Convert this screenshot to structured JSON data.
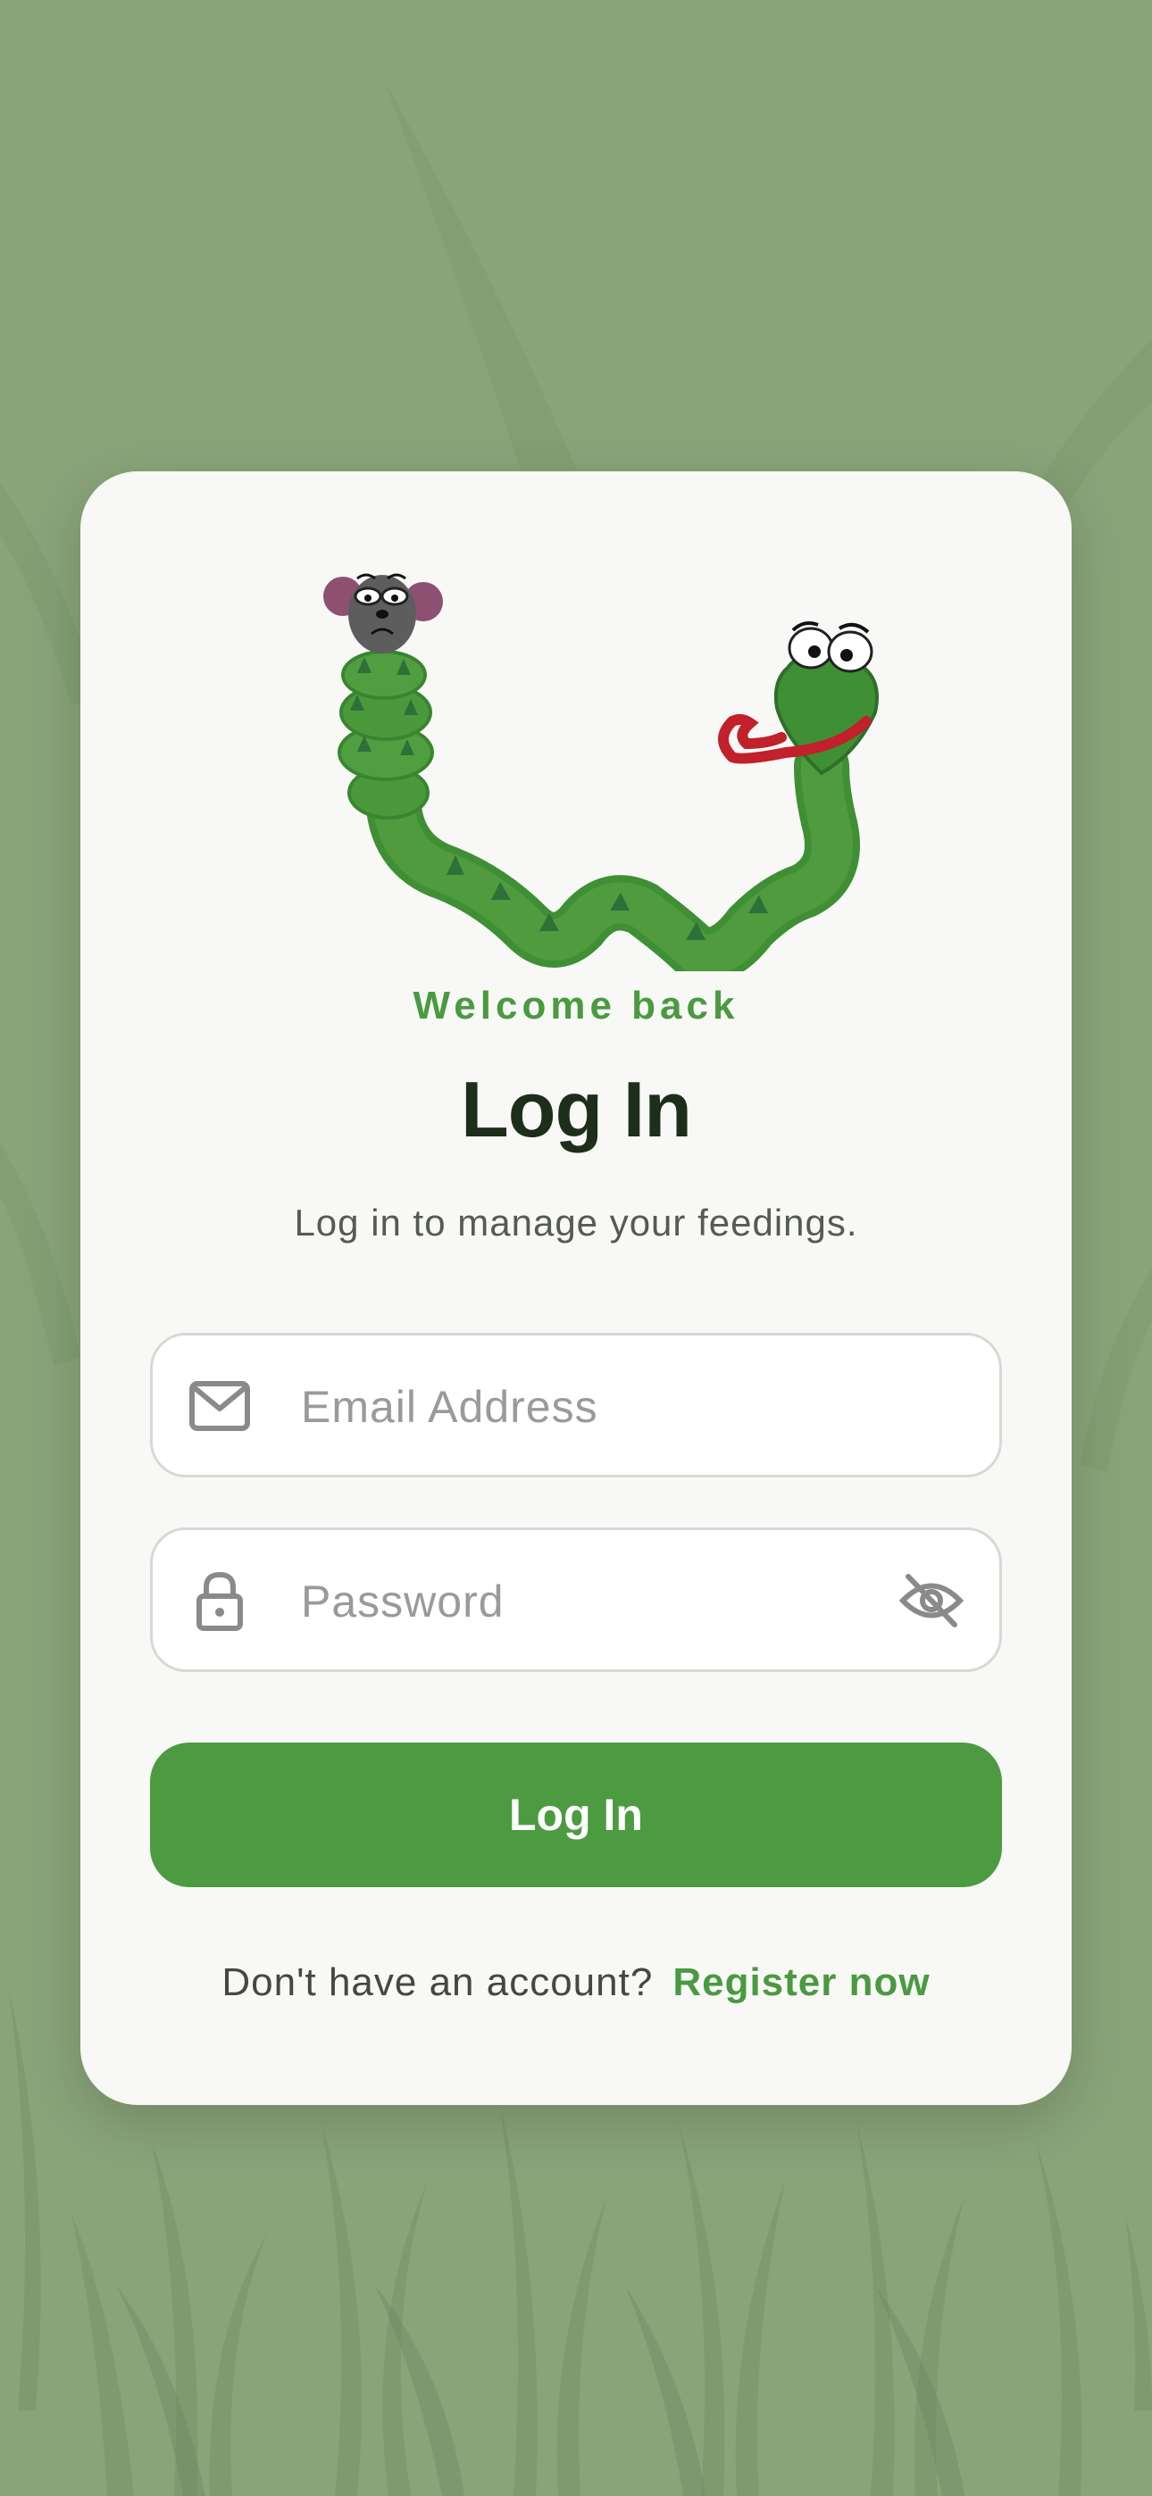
{
  "theme": {
    "background": "#8aa47a",
    "card": "#f8f8f6",
    "accent": "#4c9b41",
    "title_color": "#1d2e1b"
  },
  "login": {
    "eyebrow": "Welcome back",
    "title": "Log In",
    "subtitle": "Log in to manage your feedings.",
    "email": {
      "placeholder": "Email Address",
      "value": "",
      "icon": "mail-icon"
    },
    "password": {
      "placeholder": "Password",
      "value": "",
      "icon": "lock-icon",
      "toggle_icon": "eye-off-icon"
    },
    "submit_label": "Log In",
    "register_prompt": "Don't have an account?",
    "register_link": "Register now"
  }
}
